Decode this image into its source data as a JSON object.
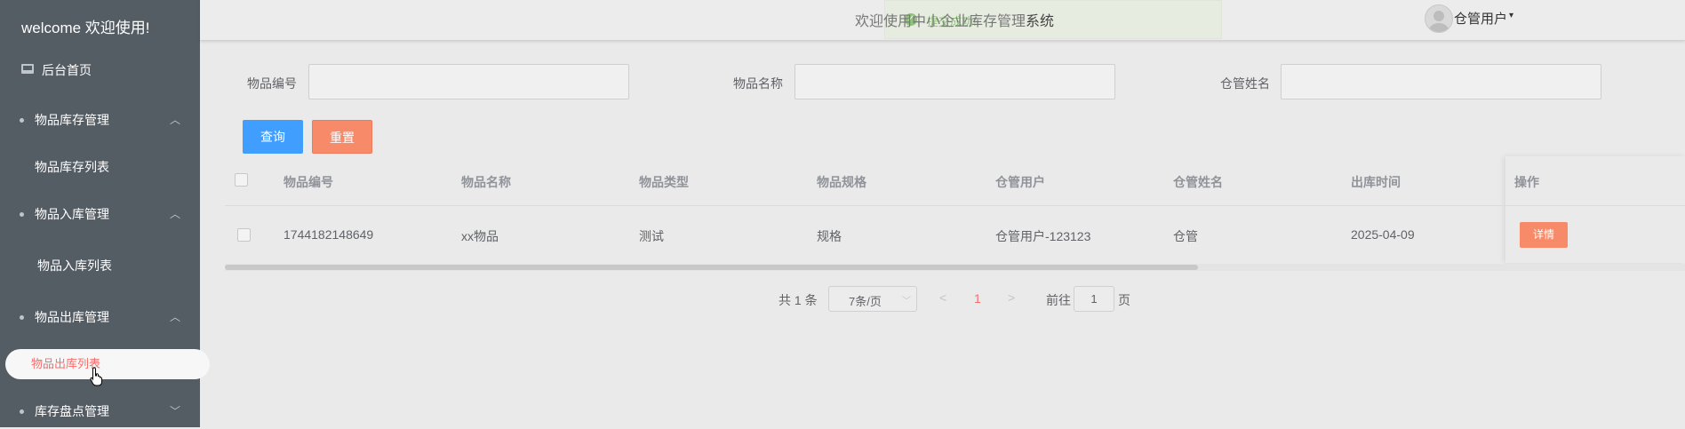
{
  "sidebar": {
    "welcome": "welcome 欢迎使用!",
    "home": "后台首页",
    "groups": [
      {
        "label": "物品库存管理",
        "sub": "物品库存列表"
      },
      {
        "label": "物品入库管理",
        "sub": "物品入库列表"
      },
      {
        "label": "物品出库管理",
        "sub": "物品出库列表"
      },
      {
        "label": "库存盘点管理"
      }
    ]
  },
  "header": {
    "toast": "提交成功!",
    "title_prefix": "欢迎使用中小企业库存管理",
    "title_suffix": "系统",
    "user": "仓管用户"
  },
  "search": {
    "item_no_label": "物品编号",
    "item_name_label": "物品名称",
    "keeper_name_label": "仓管姓名",
    "query_button": "查询",
    "reset_button": "重置"
  },
  "table": {
    "headers": [
      "物品编号",
      "物品名称",
      "物品类型",
      "物品规格",
      "仓管用户",
      "仓管姓名",
      "出库时间",
      "操作"
    ],
    "rows": [
      [
        "1744182148649",
        "xx物品",
        "测试",
        "规格",
        "仓管用户-123123",
        "仓管",
        "2025-04-09"
      ]
    ],
    "detail_button": "详情"
  },
  "pagination": {
    "total": "共 1 条",
    "page_size": "7条/页",
    "current": "1",
    "goto": "前往",
    "goto_value": "1",
    "page_suffix": "页"
  },
  "colors": {
    "sidebar_bg": "#545c64",
    "active_text": "#f56c6c",
    "primary": "#409eff",
    "reset": "#f78a68",
    "toast": "#8fc479"
  }
}
